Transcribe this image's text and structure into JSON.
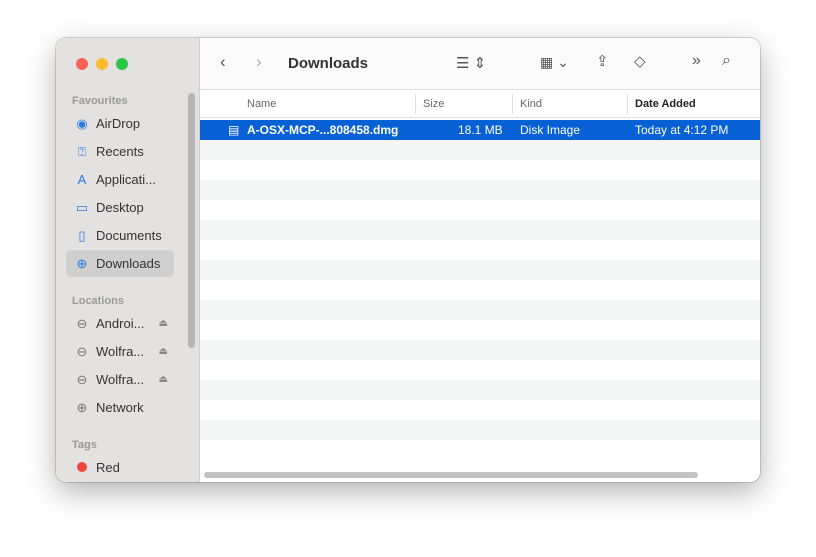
{
  "window": {
    "title": "Downloads"
  },
  "sidebar": {
    "favourites_label": "Favourites",
    "favourites": [
      {
        "label": "AirDrop",
        "icon": "airdrop-icon"
      },
      {
        "label": "Recents",
        "icon": "recents-icon"
      },
      {
        "label": "Applicati...",
        "icon": "applications-icon"
      },
      {
        "label": "Desktop",
        "icon": "desktop-icon"
      },
      {
        "label": "Documents",
        "icon": "document-icon"
      },
      {
        "label": "Downloads",
        "icon": "download-icon"
      }
    ],
    "locations_label": "Locations",
    "locations": [
      {
        "label": "Androi..."
      },
      {
        "label": "Wolfra..."
      },
      {
        "label": "Wolfra..."
      },
      {
        "label": "Network"
      }
    ],
    "tags_label": "Tags",
    "tags": [
      {
        "label": "Red",
        "color": "#f0453a"
      }
    ]
  },
  "columns": {
    "name": "Name",
    "size": "Size",
    "kind": "Kind",
    "date": "Date Added"
  },
  "files": [
    {
      "name": "A-OSX-MCP-...808458.dmg",
      "size": "18.1 MB",
      "kind": "Disk Image",
      "date": "Today at 4:12 PM"
    }
  ]
}
